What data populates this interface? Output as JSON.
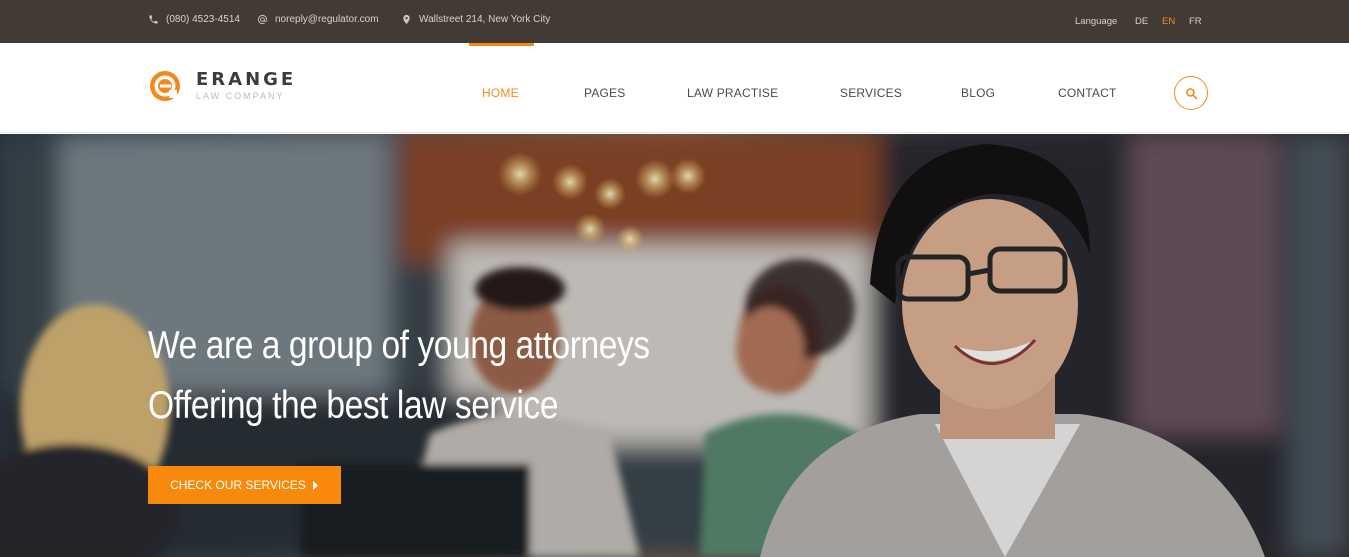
{
  "topbar": {
    "phone": "(080) 4523-4514",
    "email": "noreply@regulator.com",
    "address": "Wallstreet 214, New York City",
    "language_label": "Language",
    "languages": [
      "DE",
      "EN",
      "FR"
    ],
    "active_language": "EN"
  },
  "brand": {
    "name": "ERANGE",
    "tagline": "LAW COMPANY",
    "accent_color": "#f28a1b"
  },
  "nav": {
    "items": [
      "HOME",
      "PAGES",
      "LAW PRACTISE",
      "SERVICES",
      "BLOG",
      "CONTACT"
    ],
    "active": "HOME"
  },
  "hero": {
    "line1": "We are a group of young attorneys",
    "line2": "Offering the best law service",
    "cta_label": "CHECK OUR SERVICES",
    "cta_icon": "caret-right-icon"
  }
}
